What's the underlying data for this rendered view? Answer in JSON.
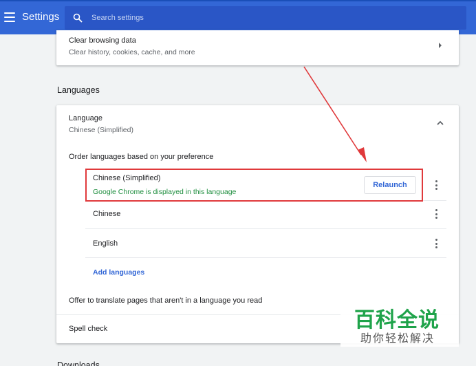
{
  "header": {
    "title": "Settings",
    "menu_icon": "hamburger-menu-icon",
    "search_placeholder": "Search settings",
    "search_icon": "search-icon"
  },
  "clear_browsing": {
    "title": "Clear browsing data",
    "subtitle": "Clear history, cookies, cache, and more",
    "icon": "chevron-right-icon"
  },
  "languages": {
    "section_title": "Languages",
    "language_label": "Language",
    "language_value": "Chinese (Simplified)",
    "collapse_icon": "chevron-up-icon",
    "order_label": "Order languages based on your preference",
    "items": [
      {
        "name": "Chinese (Simplified)",
        "note": "Google Chrome is displayed in this language",
        "button": "Relaunch"
      },
      {
        "name": "Chinese"
      },
      {
        "name": "English"
      }
    ],
    "add_languages": "Add languages",
    "offer_translate": "Offer to translate pages that aren't in a language you read",
    "spell_check": "Spell check"
  },
  "next_section_partial": "Downloads",
  "watermark": {
    "main": "百科全说",
    "sub": "助你轻松解决"
  },
  "colors": {
    "header_bg": "#3367d6",
    "search_bg": "#2a56c6",
    "accent": "#3367d6",
    "success_text": "#1e8e3e",
    "annotation_red": "#e0393b",
    "watermark_green": "#1fa34a"
  }
}
